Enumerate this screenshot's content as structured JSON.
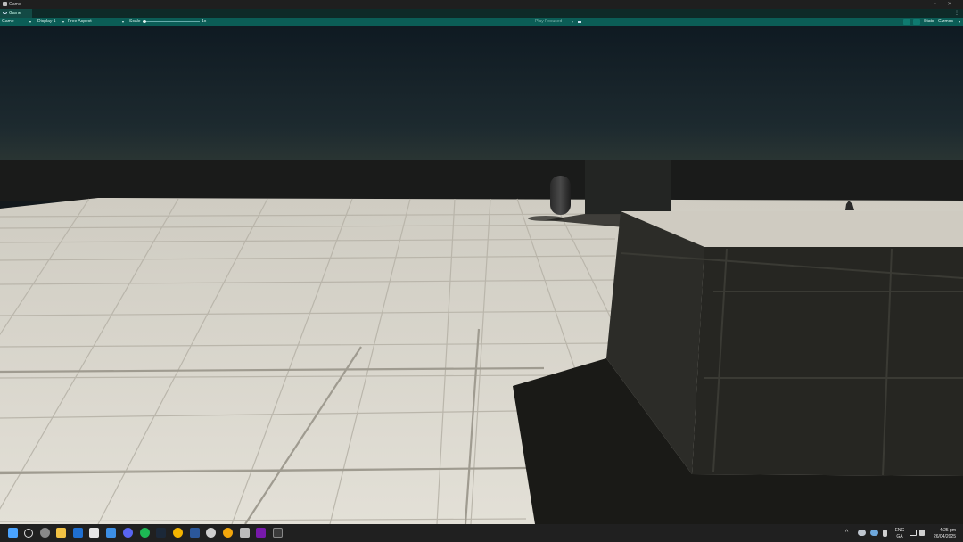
{
  "window": {
    "title": "Game"
  },
  "tab": {
    "label": "Game"
  },
  "toolbar": {
    "view_mode": "Game",
    "display": "Display 1",
    "aspect": "Free Aspect",
    "scale_label": "Scale",
    "scale_value": "1x",
    "play_mode": "Play Focused",
    "stats": "Stats",
    "gizmos": "Gizmos"
  },
  "tray": {
    "language": "ENG",
    "region": "GA",
    "time": "4:25 pm",
    "date": "26/04/2025"
  },
  "taskbar_icons": [
    "start-icon",
    "search-icon",
    "settings-icon",
    "file-explorer-icon",
    "outlook-icon",
    "photos-icon",
    "unity-icon",
    "discord-icon",
    "spotify-icon",
    "steam-icon",
    "chrome-icon",
    "word-icon",
    "unity-hub-icon",
    "chrome-canary-icon",
    "github-desktop-icon",
    "onenote-icon",
    "terminal-icon"
  ],
  "colors": {
    "accent": "#0b5d56",
    "floor": "#d8d5cc",
    "sky_top": "#0f1a22"
  }
}
